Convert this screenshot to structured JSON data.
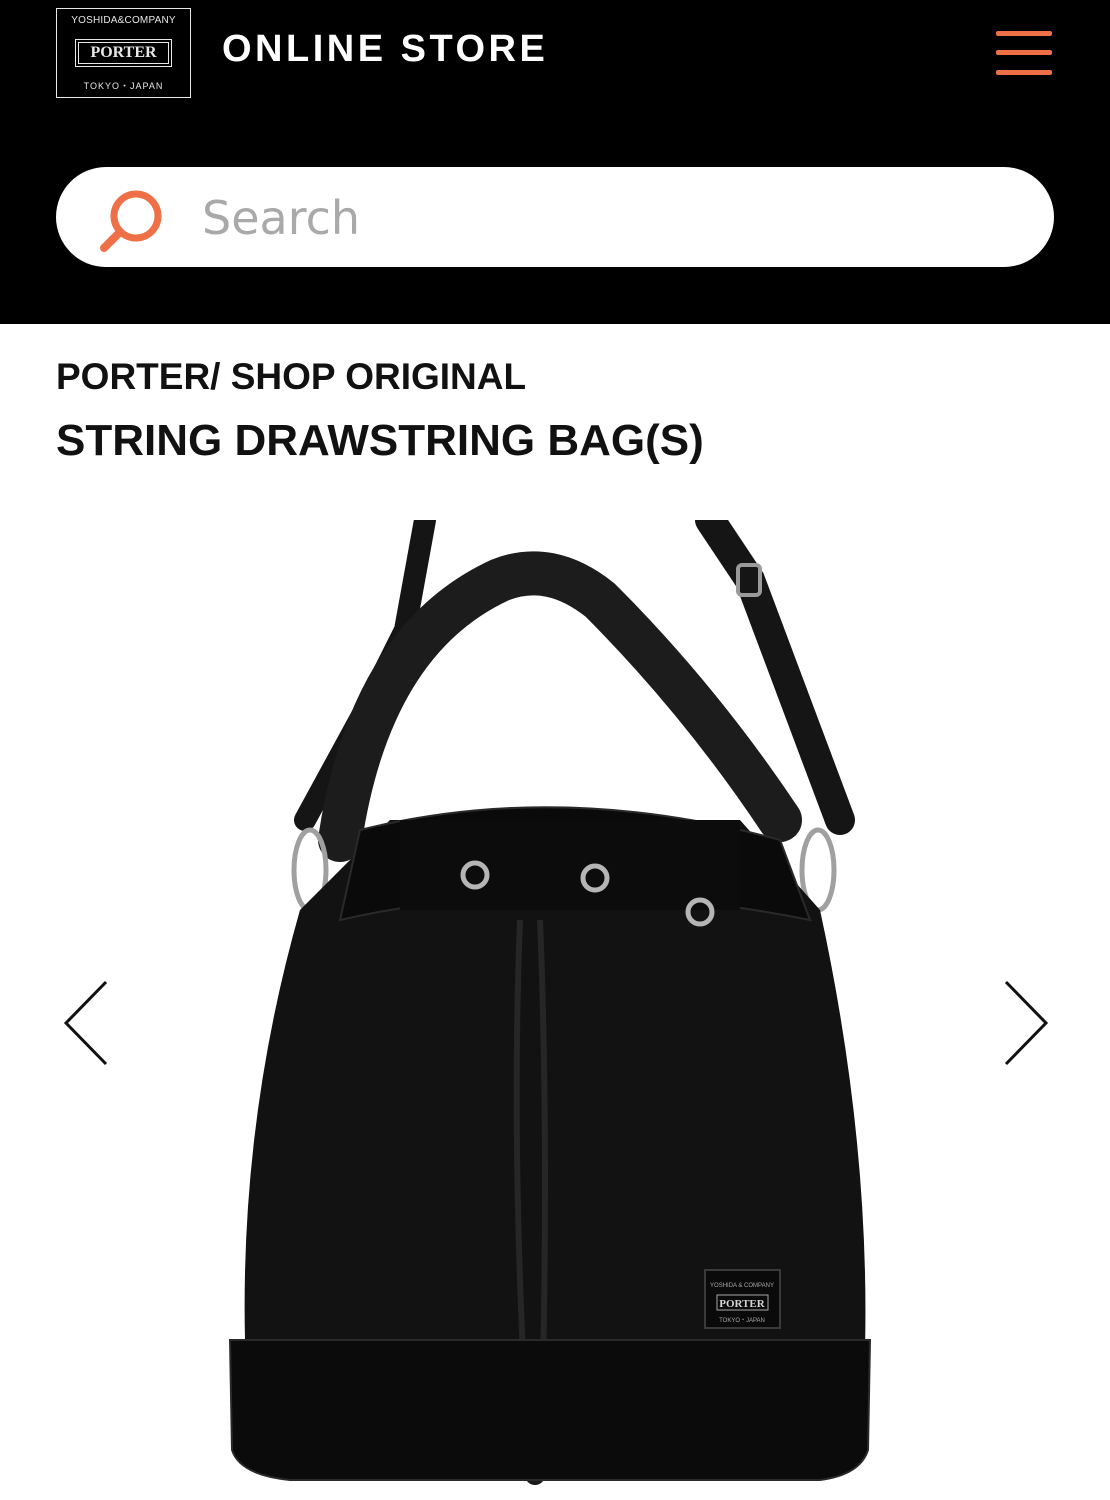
{
  "header": {
    "logo": {
      "top_text": "YOSHIDA&COMPANY",
      "brand_text": "PORTER",
      "bottom_text": "TOKYO・JAPAN"
    },
    "title": "ONLINE STORE",
    "menu_icon": "hamburger-menu-icon",
    "accent_color": "#ef6f47"
  },
  "search": {
    "placeholder": "Search",
    "icon": "search-icon"
  },
  "product": {
    "brand_line": "PORTER/ SHOP ORIGINAL",
    "title": "STRING DRAWSTRING BAG(S)",
    "image": {
      "subject": "black drawstring bucket bag",
      "label_top": "YOSHIDA & COMPANY",
      "label_brand": "PORTER",
      "label_bottom": "TOKYO・JAPAN"
    }
  },
  "carousel": {
    "prev_icon": "chevron-left-icon",
    "next_icon": "chevron-right-icon"
  }
}
